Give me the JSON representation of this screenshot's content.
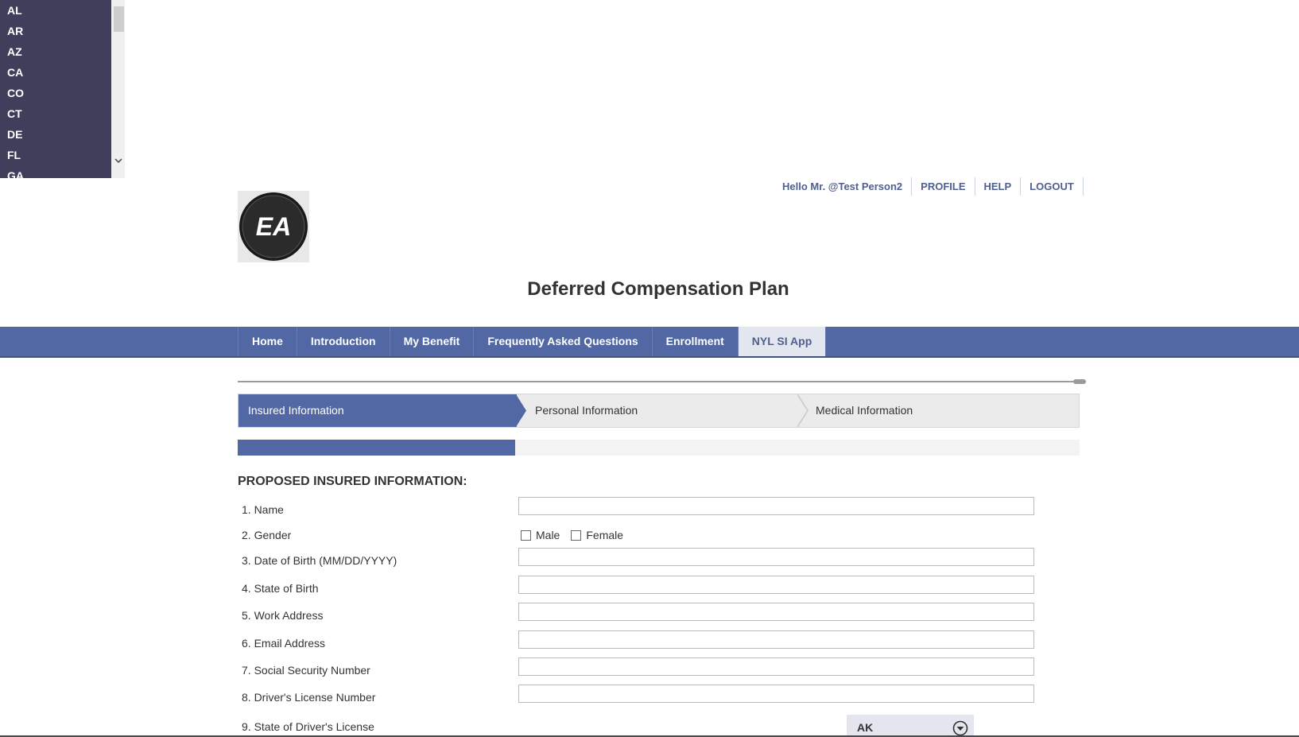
{
  "state_dropdown": {
    "options": [
      "AL",
      "AR",
      "AZ",
      "CA",
      "CO",
      "CT",
      "DE",
      "FL",
      "GA"
    ]
  },
  "header": {
    "greeting": "Hello Mr. @Test Person2",
    "profile": "PROFILE",
    "help": "HELP",
    "logout": "LOGOUT"
  },
  "logo": {
    "text": "EA"
  },
  "page_title": "Deferred Compensation Plan",
  "nav": {
    "tabs": [
      "Home",
      "Introduction",
      "My Benefit",
      "Frequently Asked Questions",
      "Enrollment",
      "NYL SI App"
    ],
    "active": "NYL SI App"
  },
  "steps": [
    "Insured Information",
    "Personal Information",
    "Medical Information"
  ],
  "progress_fraction": 0.33,
  "section_title": "PROPOSED INSURED INFORMATION:",
  "form": {
    "name": {
      "label": "1. Name",
      "value": ""
    },
    "gender": {
      "label": "2. Gender",
      "male": "Male",
      "female": "Female"
    },
    "dob": {
      "label": "3. Date of Birth (MM/DD/YYYY)",
      "value": ""
    },
    "state_birth": {
      "label": "4. State of Birth",
      "value": ""
    },
    "work_address": {
      "label": "5. Work Address",
      "value": ""
    },
    "email": {
      "label": "6. Email Address",
      "value": ""
    },
    "ssn": {
      "label": "7. Social Security Number",
      "value": ""
    },
    "license": {
      "label": "8. Driver's License Number",
      "value": ""
    },
    "license_state": {
      "label": "9. State of Driver's License",
      "value": "AK"
    }
  },
  "colors": {
    "brand": "#5268a4",
    "dropdown_bg": "#3f3f5c"
  }
}
